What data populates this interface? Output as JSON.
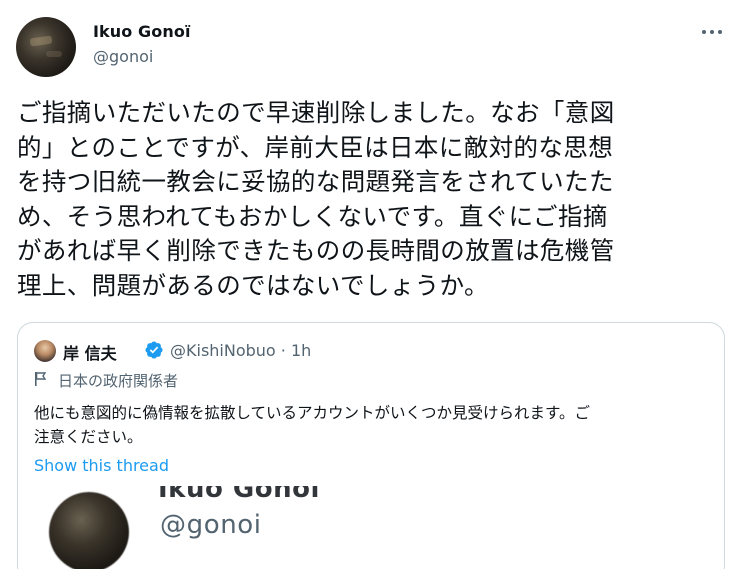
{
  "tweet": {
    "author_name": "Ikuo Gonoï",
    "author_handle": "@gonoi",
    "more_icon": "more-horizontal-icon",
    "text_lines": [
      "ご指摘いただいたので早速削除しました。なお「意図",
      "的」とのことですが、岸前大臣は日本に敵対的な思想",
      "を持つ旧統一教会に妥協的な問題発言をされていたた",
      "め、そう思われてもおかしくないです。直ぐにご指摘",
      "があれば早く削除できたものの長時間の放置は危機管",
      "理上、問題があるのではないでしょうか。"
    ]
  },
  "quoted": {
    "author_name": "岸 信夫",
    "verified_icon": "verified-badge-icon",
    "handle_time": "@KishiNobuo · 1h",
    "label_icon": "flag-icon",
    "label": "日本の政府関係者",
    "text_lines": [
      "他にも意図的に偽情報を拡散しているアカウントがいくつか見受けられます。ご",
      "注意ください。"
    ],
    "show_thread": "Show this thread",
    "media": {
      "name": "Ikuo Gonoï",
      "handle": "@gonoi"
    }
  },
  "colors": {
    "text": "#0f1419",
    "secondary": "#536471",
    "link": "#1d9bf0",
    "border": "#cfd9de"
  }
}
